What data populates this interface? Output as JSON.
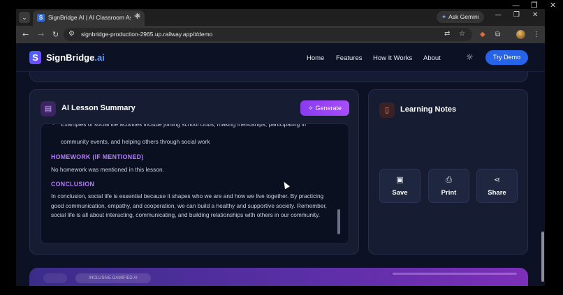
{
  "browser": {
    "tab_title": "SignBridge AI | AI Classroom As",
    "tab_close_icon": "close-icon",
    "new_tab_icon": "plus-icon",
    "ask_gemini_label": "Ask Gemini",
    "url": "signbridge-production-2965.up.railway.app/#demo",
    "icons": {
      "back": "back-arrow-icon",
      "forward": "forward-arrow-icon",
      "reload": "reload-icon",
      "site_info": "tune-icon",
      "translate": "translate-icon",
      "bookmark": "star-icon",
      "extension": "puzzle-icon",
      "menu": "more-vert-icon"
    }
  },
  "site": {
    "logo_text": "SignBridge",
    "logo_suffix": ".ai",
    "nav": [
      "Home",
      "Features",
      "How It Works",
      "About"
    ],
    "try_demo_label": "Try Demo"
  },
  "summary": {
    "title": "AI Lesson Summary",
    "generate_label": "Generate",
    "bullet_partial_top": "Examples of social life activities include joining school clubs, making friendships, participating in",
    "bullet_text": "community events, and helping others through social work",
    "homework_heading": "HOMEWORK (IF MENTIONED)",
    "homework_text": "No homework was mentioned in this lesson.",
    "conclusion_heading": "CONCLUSION",
    "conclusion_text": "In conclusion, social life is essential because it shapes who we are and how we live together. By practicing good communication, empathy, and cooperation, we can build a healthy and supportive society. Remember, social life is all about interacting, communicating, and building relationships with others in our community."
  },
  "notes": {
    "title": "Learning Notes",
    "buttons": [
      {
        "label": "Save",
        "icon": "save-icon"
      },
      {
        "label": "Print",
        "icon": "print-icon"
      },
      {
        "label": "Share",
        "icon": "share-icon"
      }
    ]
  },
  "bottom_section": {
    "partial_label": "INCLUSIVE GAMIFIED AI"
  },
  "colors": {
    "accent_purple": "#a64ef8",
    "accent_blue": "#2563eb",
    "heading_purple": "#b57cff",
    "page_bg": "#0c1124"
  }
}
